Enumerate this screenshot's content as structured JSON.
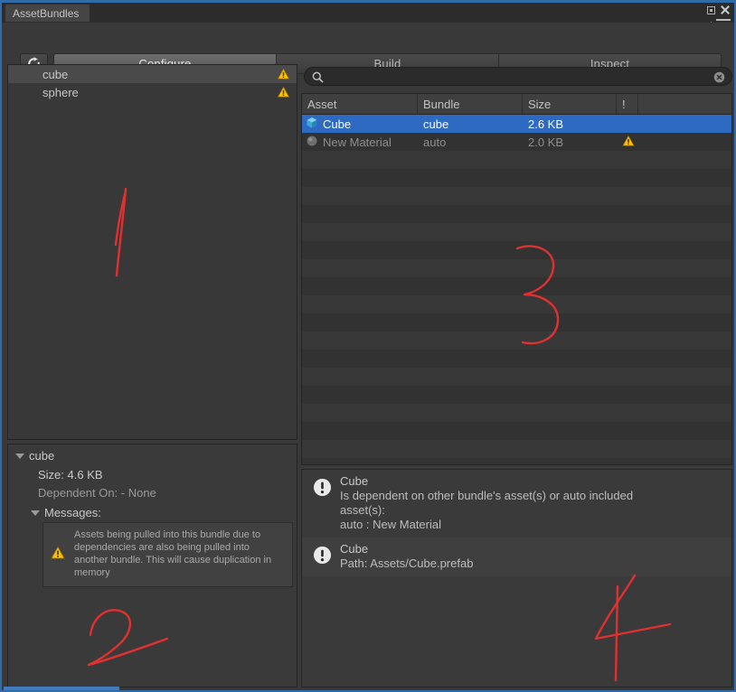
{
  "window": {
    "title": "AssetBundles",
    "buttons": {
      "maximize": "maximize-icon",
      "close": "close-icon",
      "menu": "menu-icon"
    }
  },
  "toolbar": {
    "refresh_label": "refresh-icon",
    "tabs": [
      {
        "label": "Configure",
        "active": true
      },
      {
        "label": "Build",
        "active": false
      },
      {
        "label": "Inspect",
        "active": false
      }
    ]
  },
  "bundle_tree": {
    "items": [
      {
        "label": "cube",
        "selected": true,
        "warning": true
      },
      {
        "label": "sphere",
        "selected": false,
        "warning": true
      }
    ]
  },
  "search": {
    "value": "",
    "placeholder": "",
    "icon": "search-icon",
    "clear_icon": "clear-icon"
  },
  "asset_table": {
    "columns": [
      "Asset",
      "Bundle",
      "Size",
      "!"
    ],
    "rows": [
      {
        "asset": "Cube",
        "bundle": "cube",
        "size": "2.6 KB",
        "warning": false,
        "selected": true,
        "icon": "prefab-cube-icon"
      },
      {
        "asset": "New Material",
        "bundle": "auto",
        "size": "2.0 KB",
        "warning": true,
        "selected": false,
        "icon": "material-sphere-icon"
      }
    ]
  },
  "bundle_detail": {
    "name": "cube",
    "size_label": "Size:  4.6 KB",
    "dependent_label": "Dependent On: - None",
    "messages_label": "Messages:",
    "message_text": "Assets being pulled into this bundle due to dependencies are also being pulled into another bundle.  This will cause duplication in memory"
  },
  "messages_panel": {
    "items": [
      {
        "title": "Cube",
        "body_line1": "Is dependent on other bundle's asset(s) or auto included",
        "body_line2": "asset(s):",
        "body_line3": "auto : New Material"
      },
      {
        "title": "Cube",
        "body_line1": "Path: Assets/Cube.prefab",
        "body_line2": "",
        "body_line3": ""
      }
    ]
  },
  "annotations": {
    "marks": [
      "1",
      "2",
      "3",
      "4"
    ],
    "color": "#e03030"
  },
  "colors": {
    "window_border": "#2f6ca8",
    "selection_blue": "#2f6ac2",
    "warning_yellow": "#ffc107",
    "panel_bg": "#383838"
  }
}
